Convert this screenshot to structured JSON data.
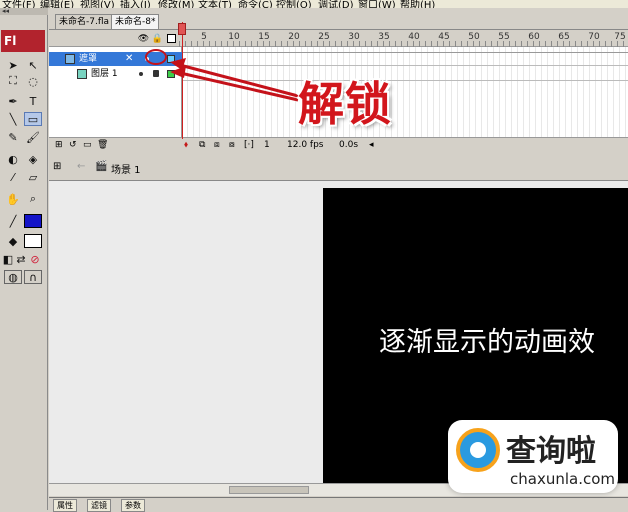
{
  "menubar": {
    "items": [
      "文件(F)",
      "编辑(E)",
      "视图(V)",
      "插入(I)",
      "修改(M)",
      "文本(T)",
      "命令(C)",
      "控制(O)",
      "调试(D)",
      "窗口(W)",
      "帮助(H)"
    ]
  },
  "toolbar": {
    "logo": "Fl"
  },
  "tabs": [
    {
      "label": "未命名-7.fla"
    },
    {
      "label": "未命名-8*"
    }
  ],
  "timeline": {
    "header_icons": [
      "eye-icon",
      "lock-icon",
      "outline-icon"
    ],
    "ruler_numbers": [
      "5",
      "10",
      "15",
      "20",
      "25",
      "30",
      "35",
      "40",
      "45",
      "50",
      "55",
      "60",
      "65",
      "70",
      "75"
    ],
    "layers": [
      {
        "name": "遮罩",
        "type": "mask"
      },
      {
        "name": "图层 1",
        "type": "masked"
      }
    ],
    "current_frame": "1",
    "fps": "12.0 fps",
    "elapsed": "0.0s"
  },
  "annotation": {
    "label": "解锁",
    "color": "#d2161c"
  },
  "scene": {
    "label": "场景 1"
  },
  "stage": {
    "text": "逐渐显示的动画效",
    "background": "#000000"
  },
  "bottom_tabs": [
    "属性",
    "滤镜",
    "参数"
  ],
  "watermark": {
    "title": "查询啦",
    "url": "chaxunla.com"
  }
}
